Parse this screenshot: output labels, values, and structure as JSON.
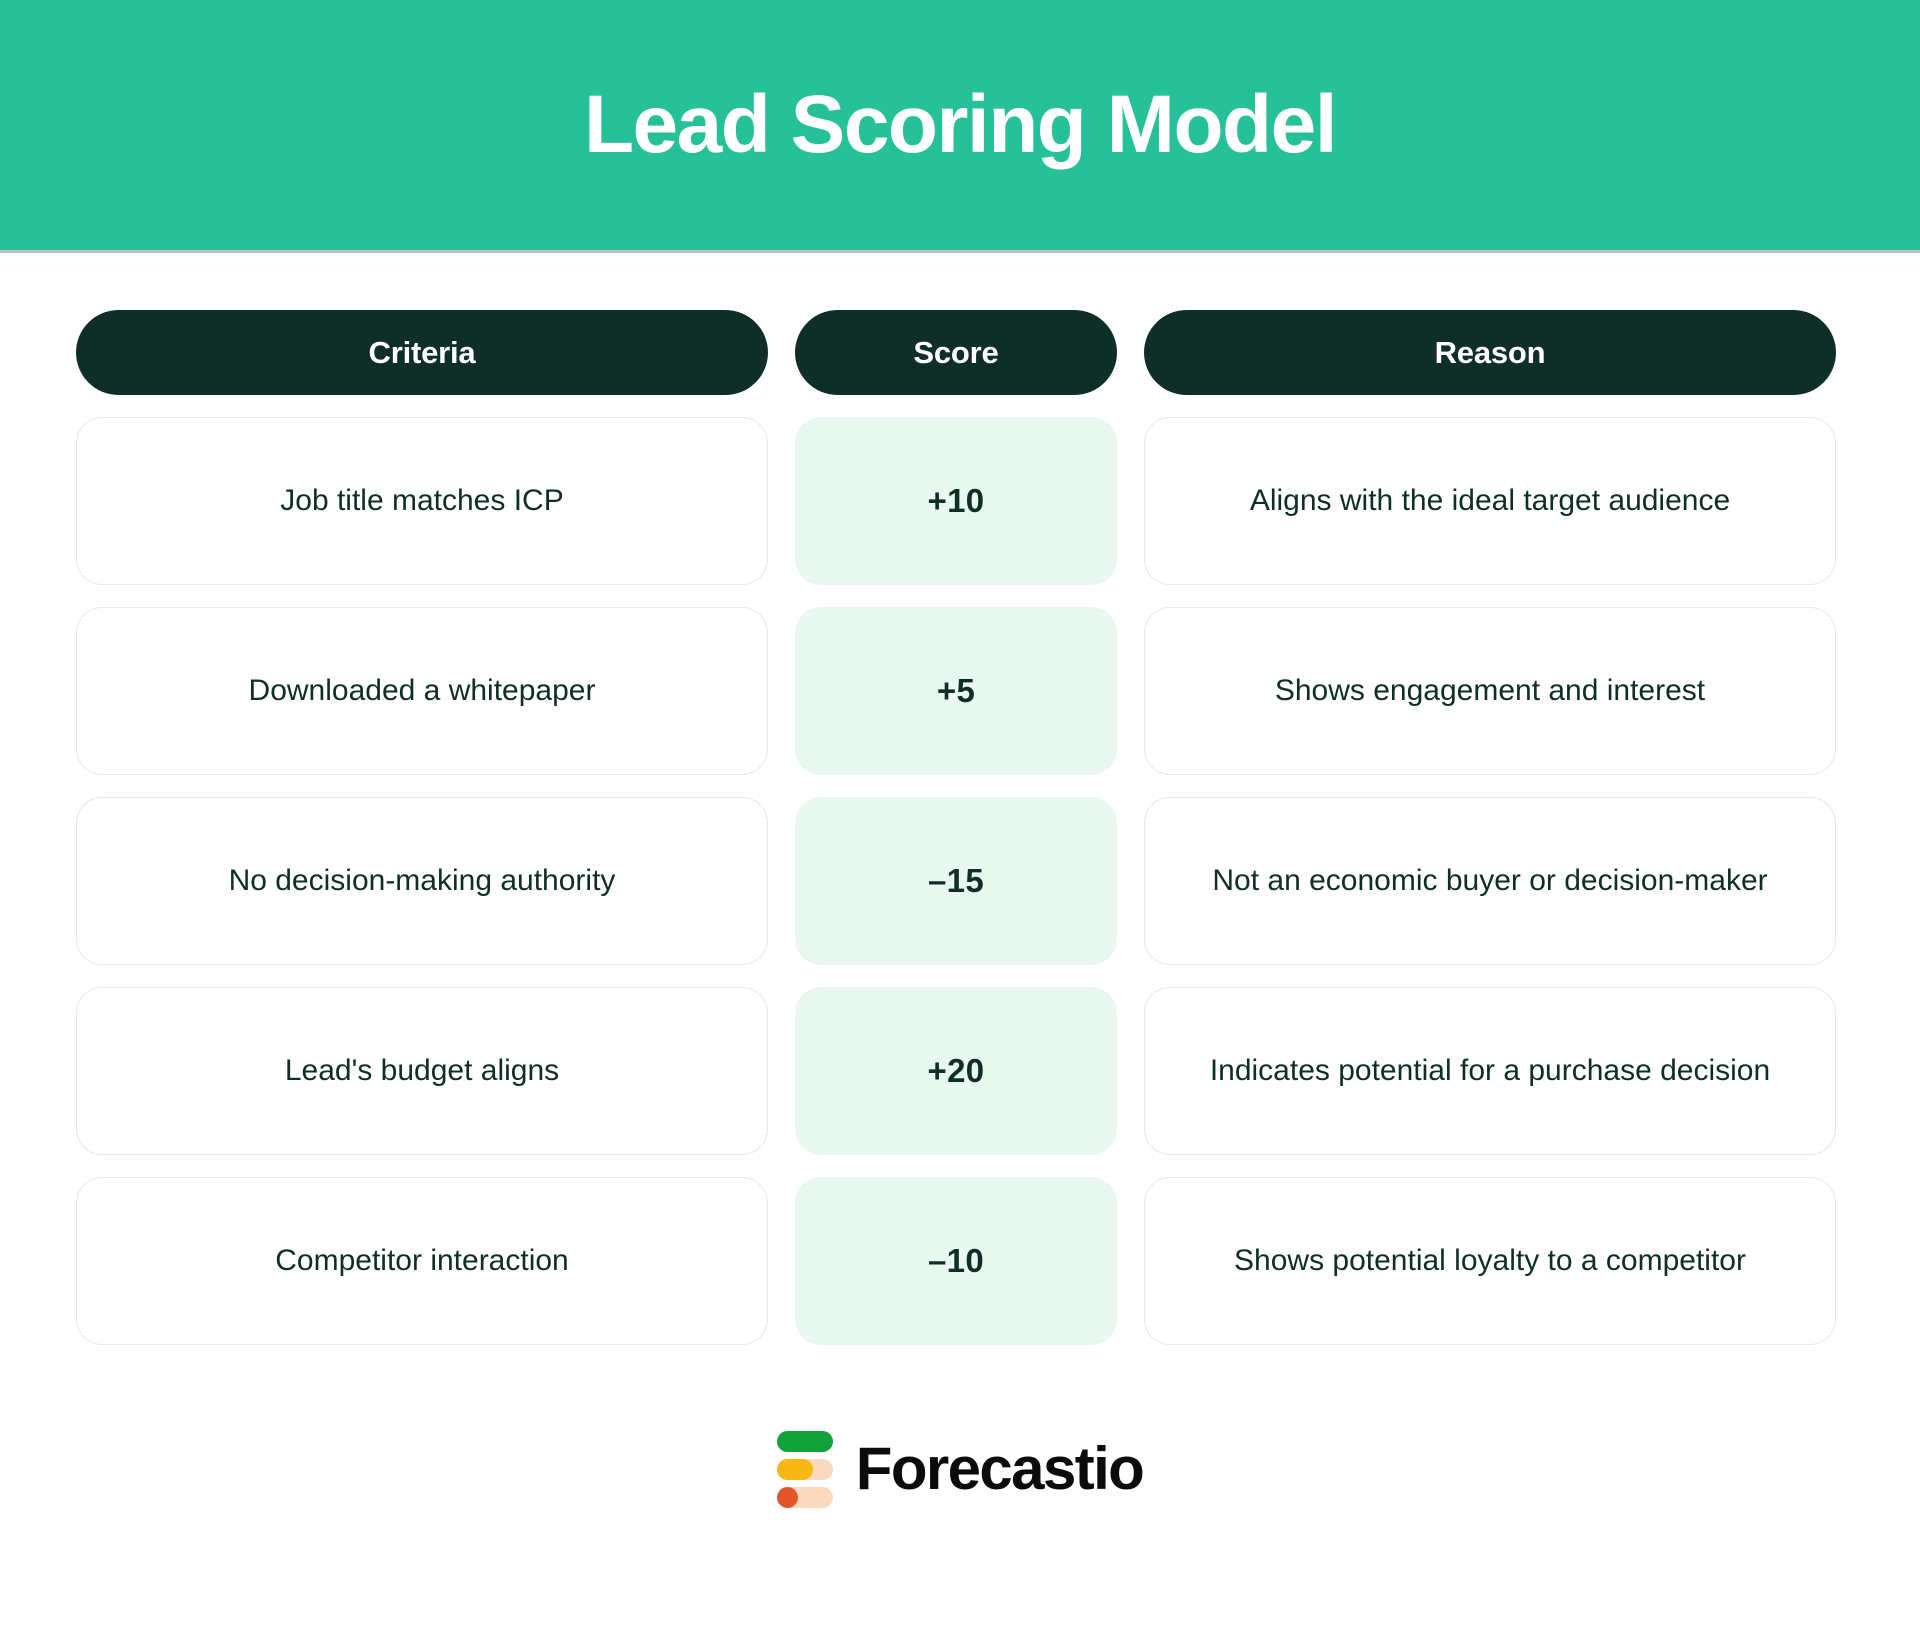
{
  "banner": {
    "title": "Lead Scoring Model",
    "background_color": "#26C199",
    "text_color": "#FFFFFF"
  },
  "table": {
    "header_background_color": "#0F2E27",
    "score_cell_background_color": "#E8F8F1",
    "body_text_color": "#0F2E27",
    "columns": [
      {
        "key": "criteria",
        "label": "Criteria"
      },
      {
        "key": "score",
        "label": "Score"
      },
      {
        "key": "reason",
        "label": "Reason"
      }
    ],
    "rows": [
      {
        "criteria": "Job title matches ICP",
        "score": "+10",
        "reason": "Aligns with the ideal target audience"
      },
      {
        "criteria": "Downloaded a whitepaper",
        "score": "+5",
        "reason": "Shows engagement and interest"
      },
      {
        "criteria": "No decision-making authority",
        "score": "–15",
        "reason": "Not an economic buyer or decision-maker"
      },
      {
        "criteria": "Lead's budget aligns",
        "score": "+20",
        "reason": "Indicates potential for a purchase decision"
      },
      {
        "criteria": "Competitor interaction",
        "score": "–10",
        "reason": "Shows potential loyalty to a competitor"
      }
    ]
  },
  "footer": {
    "logo_wordmark": "Forecastio",
    "logo_bars": [
      {
        "name": "green-bar",
        "color": "#12A23C",
        "track_color": "#FBD9BF"
      },
      {
        "name": "amber-bar",
        "color": "#F9B714",
        "track_color": "#FBD9BF"
      },
      {
        "name": "orange-dot",
        "color": "#E2562A",
        "track_color": "#FBD9BF"
      }
    ]
  }
}
